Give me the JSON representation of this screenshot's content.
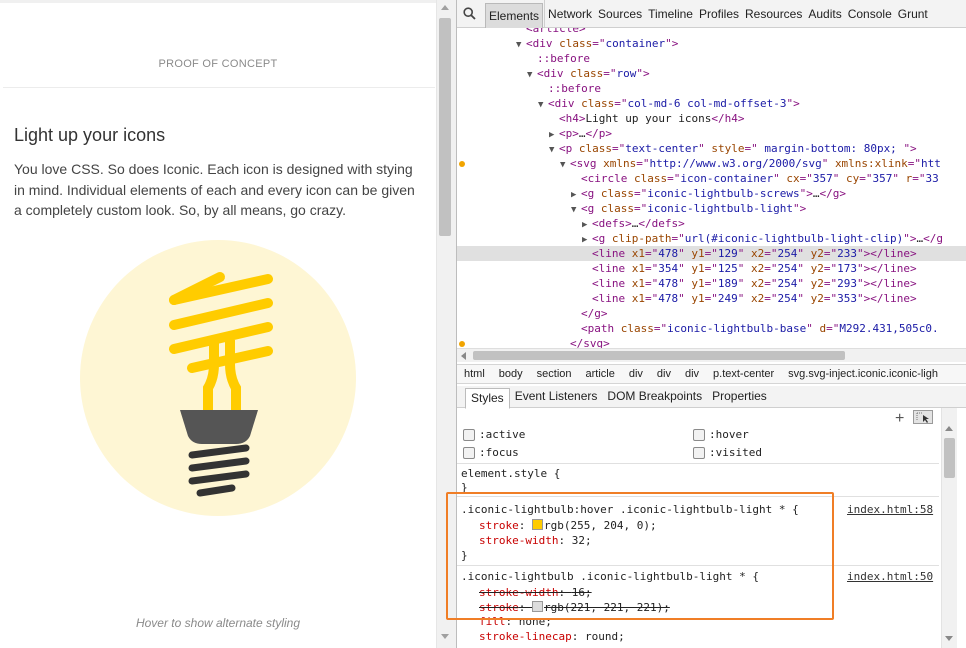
{
  "page": {
    "header": "PROOF OF CONCEPT",
    "heading": "Light up your icons",
    "body": "You love CSS. So does Iconic. Each icon is designed with stying in mind. Individual elements of each and every icon can be given a completely custom look. So, by all means, go crazy.",
    "caption": "Hover to show alternate styling",
    "colors": {
      "bulb_light": "#ffcc00",
      "bulb_circle": "#fef6d4",
      "bulb_screws": "#555555",
      "bulb_base": "#333333"
    }
  },
  "devtools": {
    "tabs": [
      "Elements",
      "Network",
      "Sources",
      "Timeline",
      "Profiles",
      "Resources",
      "Audits",
      "Console",
      "Grunt"
    ],
    "active_tab": "Elements",
    "dom_lines": [
      {
        "indent": 5,
        "tri": "",
        "html": "<span class='tag'>&lt;article&gt;</span>"
      },
      {
        "indent": 5,
        "tri": "▼",
        "html": "<span class='tag'>&lt;div </span><span class='an'>class</span><span class='tag'>=\"</span><span class='av'>container</span><span class='tag'>\"&gt;</span>"
      },
      {
        "indent": 6,
        "tri": "",
        "html": "<span class='ps'>::before</span>"
      },
      {
        "indent": 6,
        "tri": "▼",
        "html": "<span class='tag'>&lt;div </span><span class='an'>class</span><span class='tag'>=\"</span><span class='av'>row</span><span class='tag'>\"&gt;</span>"
      },
      {
        "indent": 7,
        "tri": "",
        "html": "<span class='ps'>::before</span>"
      },
      {
        "indent": 7,
        "tri": "▼",
        "html": "<span class='tag'>&lt;div </span><span class='an'>class</span><span class='tag'>=\"</span><span class='av'>col-md-6 col-md-offset-3</span><span class='tag'>\"&gt;</span>"
      },
      {
        "indent": 8,
        "tri": "",
        "html": "<span class='tag'>&lt;h4&gt;</span><span class='tx'>Light up your icons</span><span class='tag'>&lt;/h4&gt;</span>"
      },
      {
        "indent": 8,
        "tri": "▶",
        "html": "<span class='tag'>&lt;p&gt;</span><span class='tx'>…</span><span class='tag'>&lt;/p&gt;</span>"
      },
      {
        "indent": 8,
        "tri": "▼",
        "html": "<span class='tag'>&lt;p </span><span class='an'>class</span><span class='tag'>=\"</span><span class='av'>text-center</span><span class='tag'>\" </span><span class='an'>style</span><span class='tag'>=\"</span><span class='av'> margin-bottom: 80px; </span><span class='tag'>\"&gt;</span>"
      },
      {
        "indent": 9,
        "tri": "▼",
        "dot": true,
        "html": "<span class='tag'>&lt;svg </span><span class='an'>xmlns</span><span class='tag'>=\"</span><span class='av'>http://www.w3.org/2000/svg</span><span class='tag'>\" </span><span class='an'>xmlns:xlink</span><span class='tag'>=\"</span><span class='av'>htt</span>"
      },
      {
        "indent": 10,
        "tri": "",
        "html": "<span class='tag'>&lt;circle </span><span class='an'>class</span><span class='tag'>=\"</span><span class='av'>icon-container</span><span class='tag'>\" </span><span class='an'>cx</span><span class='tag'>=\"</span><span class='av'>357</span><span class='tag'>\" </span><span class='an'>cy</span><span class='tag'>=\"</span><span class='av'>357</span><span class='tag'>\" </span><span class='an'>r</span><span class='tag'>=\"</span><span class='av'>33</span>"
      },
      {
        "indent": 10,
        "tri": "▶",
        "html": "<span class='tag'>&lt;g </span><span class='an'>class</span><span class='tag'>=\"</span><span class='av'>iconic-lightbulb-screws</span><span class='tag'>\"&gt;</span><span class='tx'>…</span><span class='tag'>&lt;/g&gt;</span>"
      },
      {
        "indent": 10,
        "tri": "▼",
        "html": "<span class='tag'>&lt;g </span><span class='an'>class</span><span class='tag'>=\"</span><span class='av'>iconic-lightbulb-light</span><span class='tag'>\"&gt;</span>"
      },
      {
        "indent": 11,
        "tri": "▶",
        "html": "<span class='tag'>&lt;defs&gt;</span><span class='tx'>…</span><span class='tag'>&lt;/defs&gt;</span>"
      },
      {
        "indent": 11,
        "tri": "▶",
        "html": "<span class='tag'>&lt;g </span><span class='an'>clip-path</span><span class='tag'>=\"</span><span class='av'>url(#iconic-lightbulb-light-clip)</span><span class='tag'>\"&gt;</span><span class='tx'>…</span><span class='tag'>&lt;/g</span>"
      },
      {
        "indent": 11,
        "tri": "",
        "sel": true,
        "html": "<span class='tag'>&lt;line </span><span class='an'>x1</span><span class='tag'>=\"</span><span class='av'>478</span><span class='tag'>\" </span><span class='an'>y1</span><span class='tag'>=\"</span><span class='av'>129</span><span class='tag'>\" </span><span class='an'>x2</span><span class='tag'>=\"</span><span class='av'>254</span><span class='tag'>\" </span><span class='an'>y2</span><span class='tag'>=\"</span><span class='av'>233</span><span class='tag'>\"&gt;&lt;/line&gt;</span>"
      },
      {
        "indent": 11,
        "tri": "",
        "html": "<span class='tag'>&lt;line </span><span class='an'>x1</span><span class='tag'>=\"</span><span class='av'>354</span><span class='tag'>\" </span><span class='an'>y1</span><span class='tag'>=\"</span><span class='av'>125</span><span class='tag'>\" </span><span class='an'>x2</span><span class='tag'>=\"</span><span class='av'>254</span><span class='tag'>\" </span><span class='an'>y2</span><span class='tag'>=\"</span><span class='av'>173</span><span class='tag'>\"&gt;&lt;/line&gt;</span>"
      },
      {
        "indent": 11,
        "tri": "",
        "html": "<span class='tag'>&lt;line </span><span class='an'>x1</span><span class='tag'>=\"</span><span class='av'>478</span><span class='tag'>\" </span><span class='an'>y1</span><span class='tag'>=\"</span><span class='av'>189</span><span class='tag'>\" </span><span class='an'>x2</span><span class='tag'>=\"</span><span class='av'>254</span><span class='tag'>\" </span><span class='an'>y2</span><span class='tag'>=\"</span><span class='av'>293</span><span class='tag'>\"&gt;&lt;/line&gt;</span>"
      },
      {
        "indent": 11,
        "tri": "",
        "html": "<span class='tag'>&lt;line </span><span class='an'>x1</span><span class='tag'>=\"</span><span class='av'>478</span><span class='tag'>\" </span><span class='an'>y1</span><span class='tag'>=\"</span><span class='av'>249</span><span class='tag'>\" </span><span class='an'>x2</span><span class='tag'>=\"</span><span class='av'>254</span><span class='tag'>\" </span><span class='an'>y2</span><span class='tag'>=\"</span><span class='av'>353</span><span class='tag'>\"&gt;&lt;/line&gt;</span>"
      },
      {
        "indent": 10,
        "tri": "",
        "html": "<span class='tag'>&lt;/g&gt;</span>"
      },
      {
        "indent": 10,
        "tri": "",
        "html": "<span class='tag'>&lt;path </span><span class='an'>class</span><span class='tag'>=\"</span><span class='av'>iconic-lightbulb-base</span><span class='tag'>\" </span><span class='an'>d</span><span class='tag'>=\"</span><span class='av'>M292.431,505c0.</span>"
      },
      {
        "indent": 9,
        "tri": "",
        "dot": true,
        "html": "<span class='tag'>&lt;/svg&gt;</span>"
      }
    ],
    "breadcrumbs": [
      "html",
      "body",
      "section",
      "article",
      "div",
      "div",
      "div",
      "p.text-center",
      "svg.svg-inject.iconic.iconic-ligh"
    ],
    "subtabs": [
      "Styles",
      "Event Listeners",
      "DOM Breakpoints",
      "Properties"
    ],
    "active_subtab": "Styles",
    "states": [
      ":active",
      ":hover",
      ":focus",
      ":visited"
    ],
    "styles": {
      "element_style_open": "element.style {",
      "close": "}",
      "rule1": {
        "selector": ".iconic-lightbulb:hover .iconic-lightbulb-light * {",
        "source": "index.html:58",
        "p1_name": "stroke",
        "p1_value": "rgb(255, 204, 0);",
        "p1_swatch": "#ffcc00",
        "p2_name": "stroke-width",
        "p2_value": "32;"
      },
      "rule2": {
        "selector": ".iconic-lightbulb .iconic-lightbulb-light * {",
        "source": "index.html:50",
        "p1_name": "stroke-width",
        "p1_value": "16;",
        "p2_name": "stroke",
        "p2_value": "rgb(221, 221, 221);",
        "p2_swatch": "#dddddd",
        "p3_name": "fill",
        "p3_value": "none;",
        "p4_name": "stroke-linecap",
        "p4_value": "round;"
      }
    },
    "highlight_color": "#f07e26"
  }
}
